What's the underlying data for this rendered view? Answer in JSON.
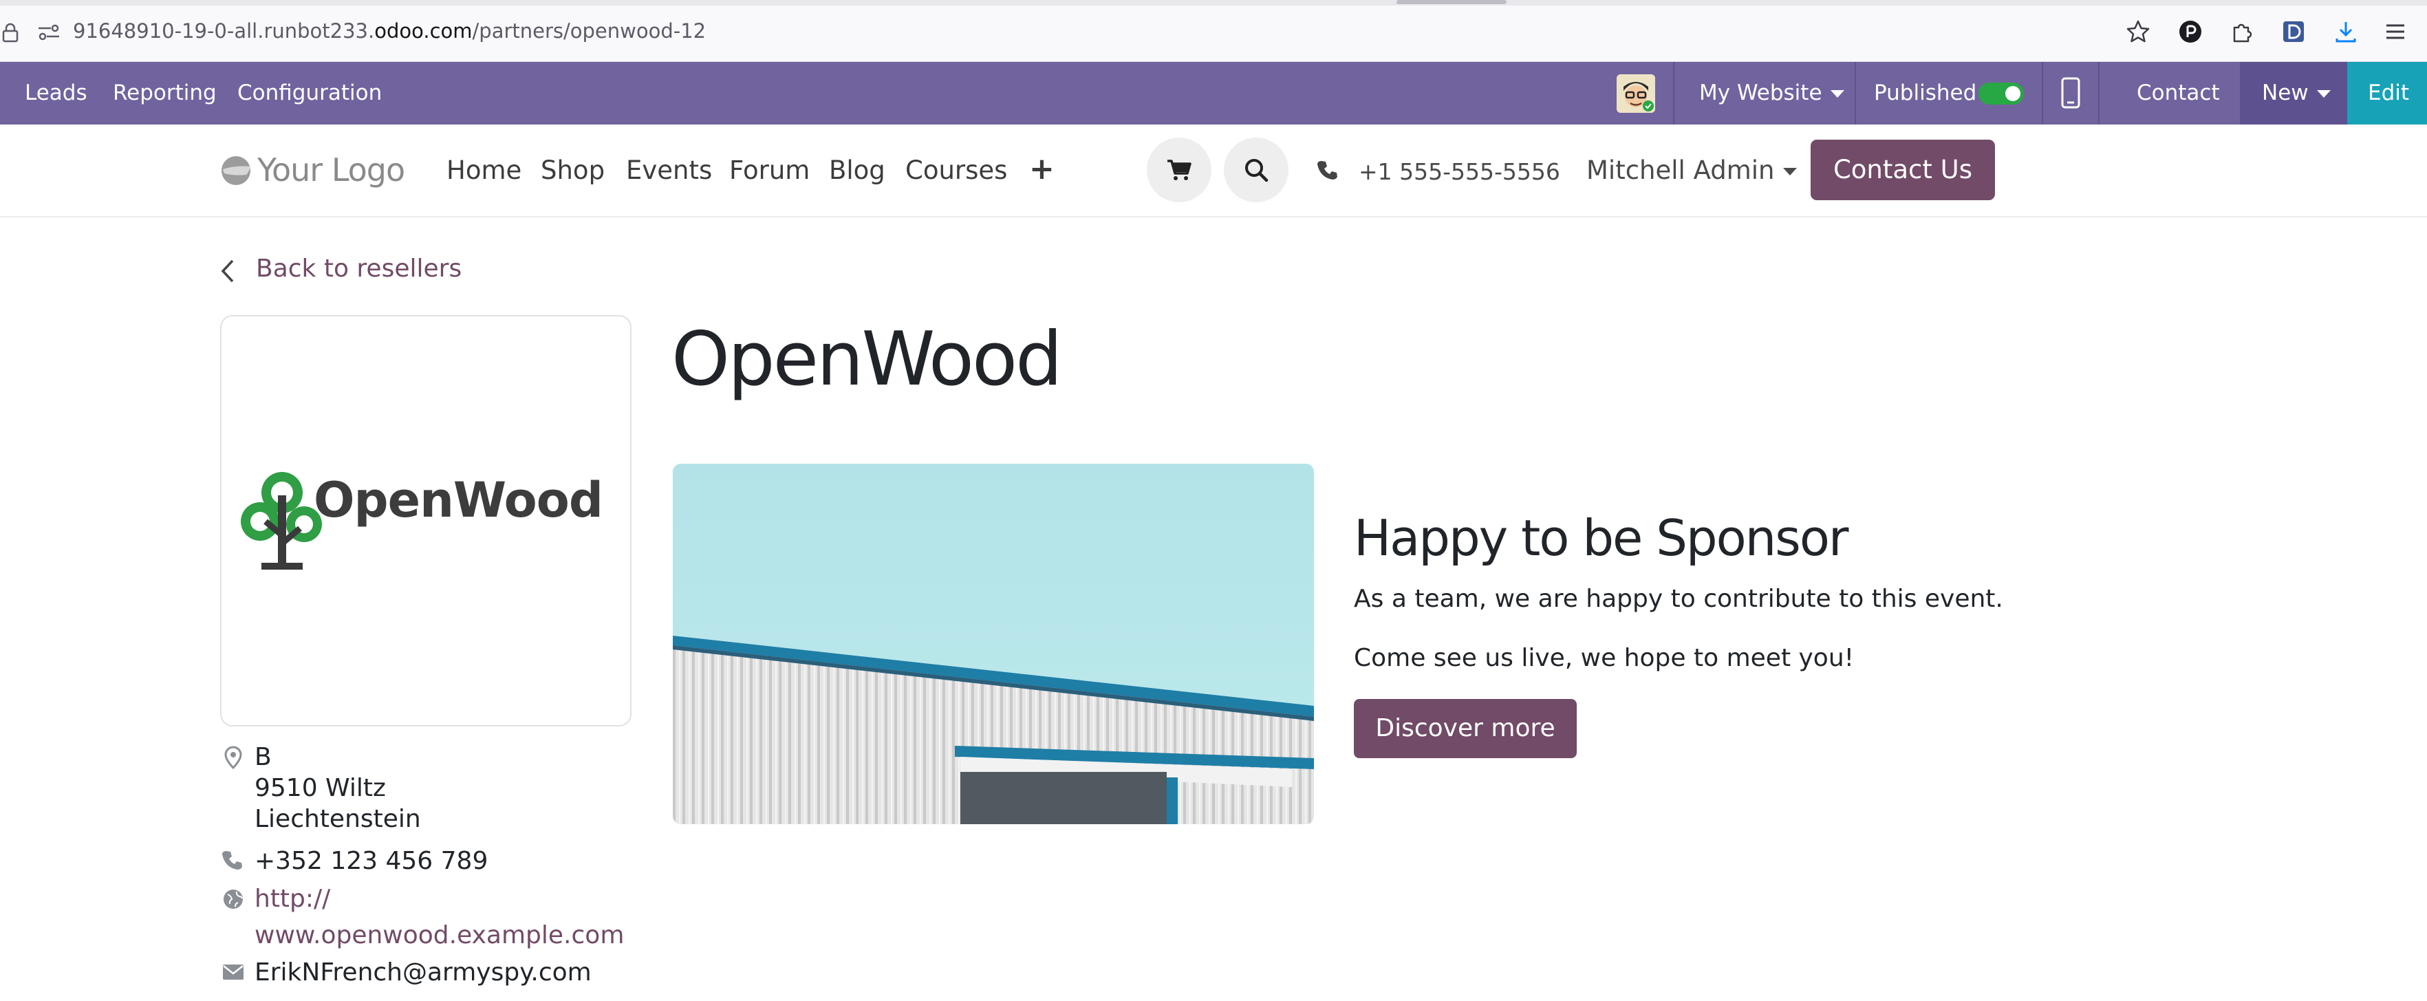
{
  "browser": {
    "url_prefix": "91648910-19-0-all.runbot233.",
    "url_domain": "odoo.com",
    "url_path": "/partners/openwood-12"
  },
  "odoo_bar": {
    "menu": [
      "Leads",
      "Reporting",
      "Configuration"
    ],
    "my_website": "My Website",
    "published": "Published",
    "contact": "Contact",
    "new": "New",
    "edit": "Edit"
  },
  "site_header": {
    "logo_text": "Your Logo",
    "nav": [
      "Home",
      "Shop",
      "Events",
      "Forum",
      "Blog",
      "Courses"
    ],
    "plus": "+",
    "phone": "+1 555-555-5556",
    "user": "Mitchell Admin",
    "cta": "Contact Us"
  },
  "content": {
    "back_link": "Back to resellers",
    "partner_logo_text": "OpenWood",
    "partner_name": "OpenWood",
    "sponsor_title": "Happy to be Sponsor",
    "sponsor_text_1": "As a team, we are happy to contribute to this event.",
    "sponsor_text_2": "Come see us live, we hope to meet you!",
    "discover_button": "Discover more"
  },
  "contact_info": {
    "address_line1": "B",
    "address_line2": "9510 Wiltz",
    "address_line3": "Liechtenstein",
    "phone": "+352 123 456 789",
    "website_line1": "http://",
    "website_line2": "www.openwood.example.com",
    "email": "ErikNFrench@armyspy.com"
  },
  "colors": {
    "odoo_purple": "#71639e",
    "brand": "#714b67",
    "edit_teal": "#17a2b8",
    "toggle_green": "#28a745"
  }
}
